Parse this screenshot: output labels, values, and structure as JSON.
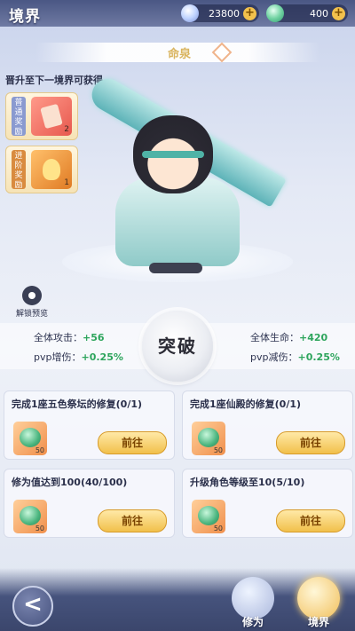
{
  "header": {
    "title": "境界",
    "currency_gem": "23800",
    "currency_jade": "400",
    "plus": "+"
  },
  "ribbon": {
    "text": "命泉"
  },
  "rewards": {
    "title": "晋升至下一境界可获得",
    "items": [
      {
        "tag": "普通奖励",
        "count": "2"
      },
      {
        "tag": "进阶奖励",
        "count": "1"
      }
    ]
  },
  "unlock_preview": "解锁预览",
  "stats": {
    "attack_label": "全体攻击：",
    "attack_value": "+56",
    "pvp_dmg_label": "pvp增伤：",
    "pvp_dmg_value": "+0.25%",
    "hp_label": "全体生命：",
    "hp_value": "+420",
    "pvp_red_label": "pvp减伤：",
    "pvp_red_value": "+0.25%"
  },
  "breakthrough_label": "突破",
  "tasks": [
    {
      "title": "完成1座五色祭坛的修复(0/1)",
      "reward_count": "50",
      "button": "前往"
    },
    {
      "title": "完成1座仙殿的修复(0/1)",
      "reward_count": "50",
      "button": "前往"
    },
    {
      "title": "修为值达到100(40/100)",
      "reward_count": "50",
      "button": "前往"
    },
    {
      "title": "升级角色等级至10(5/10)",
      "reward_count": "50",
      "button": "前往"
    }
  ],
  "bottom_nav": {
    "back_glyph": "<",
    "tab_cultivation": "修为",
    "tab_realm": "境界"
  },
  "icons": {
    "gem": "diamond-gem-icon",
    "jade": "jade-dragon-icon",
    "eye": "eye-icon",
    "back": "back-arrow-icon"
  },
  "colors": {
    "accent_gold": "#f1c04b",
    "stat_green": "#2ea55d",
    "header_blue": "#4a5784"
  }
}
